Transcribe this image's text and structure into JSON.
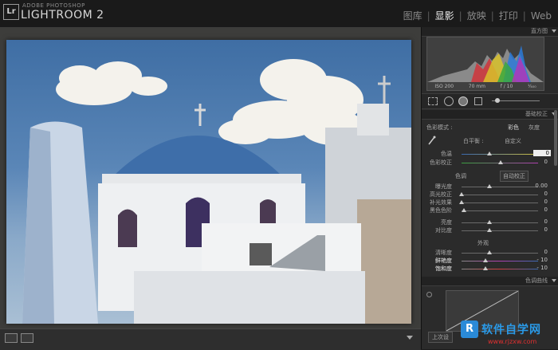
{
  "app": {
    "vendor": "ADOBE PHOTOSHOP",
    "name": "LIGHTROOM 2",
    "logo": "Lr"
  },
  "modules": [
    {
      "label": "图库",
      "active": false
    },
    {
      "label": "显影",
      "active": true
    },
    {
      "label": "放映",
      "active": false
    },
    {
      "label": "打印",
      "active": false
    },
    {
      "label": "Web",
      "active": false
    }
  ],
  "histogram": {
    "header": "直方图",
    "iso": "ISO 200",
    "focal": "70 mm",
    "aperture": "f / 10",
    "shutter": "¹⁄₄₀₀"
  },
  "basic": {
    "header": "基础校正",
    "treatment_label": "色彩模式 :",
    "treatment_color": "彩色",
    "treatment_gray": "灰度",
    "wb_label": "白平衡 :",
    "wb_value": "自定义",
    "temp_label": "色温",
    "temp_value": "0",
    "tint_label": "色彩校正",
    "tint_value": "0",
    "tone_label": "色调",
    "auto_label": "自动校正",
    "exposure_label": "曝光度",
    "exposure_value": "0.00",
    "recovery_label": "高光校正",
    "recovery_value": "0",
    "fill_label": "补光效果",
    "fill_value": "0",
    "blacks_label": "黑色色阶",
    "blacks_value": "0",
    "brightness_label": "亮度",
    "brightness_value": "0",
    "contrast_label": "对比度",
    "contrast_value": "0",
    "presence_label": "外观",
    "clarity_label": "清晰度",
    "clarity_value": "0",
    "vibrance_label": "鲜艳度",
    "vibrance_value": "- 10",
    "saturation_label": "饱和度",
    "saturation_value": "- 10"
  },
  "tone_curve": {
    "header": "色调曲线"
  },
  "bottom": {
    "previous_label": "上次设"
  },
  "watermark": {
    "text": "软件自学网",
    "url": "www.rjzxw.com"
  },
  "colors": {
    "accent": "#3a7ac8",
    "panel_bg": "#2b2b2b"
  }
}
